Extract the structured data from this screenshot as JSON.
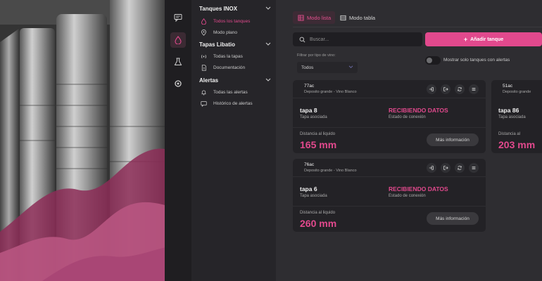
{
  "colors": {
    "accent": "#e2498d",
    "background": "#2e2d31",
    "card": "#232226",
    "sidebar": "#262529",
    "rail": "#1f1e21"
  },
  "rail": {
    "icons": [
      "chat-icon",
      "drop-icon",
      "flask-icon",
      "refresh-icon"
    ]
  },
  "nav": {
    "groups": [
      {
        "title": "Tanques INOX",
        "items": [
          {
            "label": "Todos los tanques",
            "icon": "drop-icon",
            "active": true
          },
          {
            "label": "Modo plano",
            "icon": "location-pin-icon",
            "active": false
          }
        ]
      },
      {
        "title": "Tapas Libatio",
        "items": [
          {
            "label": "Todas la tapas",
            "icon": "signal-icon",
            "active": false
          },
          {
            "label": "Documentación",
            "icon": "document-icon",
            "active": false
          }
        ]
      },
      {
        "title": "Alertas",
        "items": [
          {
            "label": "Todas las alertas",
            "icon": "bell-icon",
            "active": false
          },
          {
            "label": "Histórico de alertas",
            "icon": "message-icon",
            "active": false
          }
        ]
      }
    ]
  },
  "main": {
    "tabs": [
      {
        "label": "Modo lista",
        "icon": "grid-icon",
        "active": true
      },
      {
        "label": "Modo tabla",
        "icon": "table-icon",
        "active": false
      }
    ],
    "search": {
      "placeholder": "Buscar..."
    },
    "add_button": "Añadir tanque",
    "filter": {
      "label": "Filtrar por tipo de vino:",
      "selected": "Todos"
    },
    "alerts_toggle": {
      "label": "Mostrar solo tanques con alertas",
      "on": false
    },
    "tank_cards": [
      {
        "code": "77ac",
        "subtitle": "Deposito grande - Vino Blanco",
        "tapa": "tapa 8",
        "tapa_label": "Tapa asociada",
        "state": "RECIBIENDO DATOS",
        "state_label": "Estado de conexión",
        "distance_label": "Distancia al liquido",
        "distance": "165 mm",
        "more": "Más información"
      },
      {
        "code": "76ac",
        "subtitle": "Deposito grande - Vino Blanco",
        "tapa": "tapa 6",
        "tapa_label": "Tapa asociada",
        "state": "RECIBIENDO DATOS",
        "state_label": "Estado de conexión",
        "distance_label": "Distancia al liquido",
        "distance": "260 mm",
        "more": "Más información"
      },
      {
        "code": "51ac",
        "subtitle": "Deposito grande",
        "tapa": "tapa 86",
        "tapa_label": "Tapa asociada",
        "distance_label": "Distancia al",
        "distance": "203 mm"
      }
    ]
  }
}
